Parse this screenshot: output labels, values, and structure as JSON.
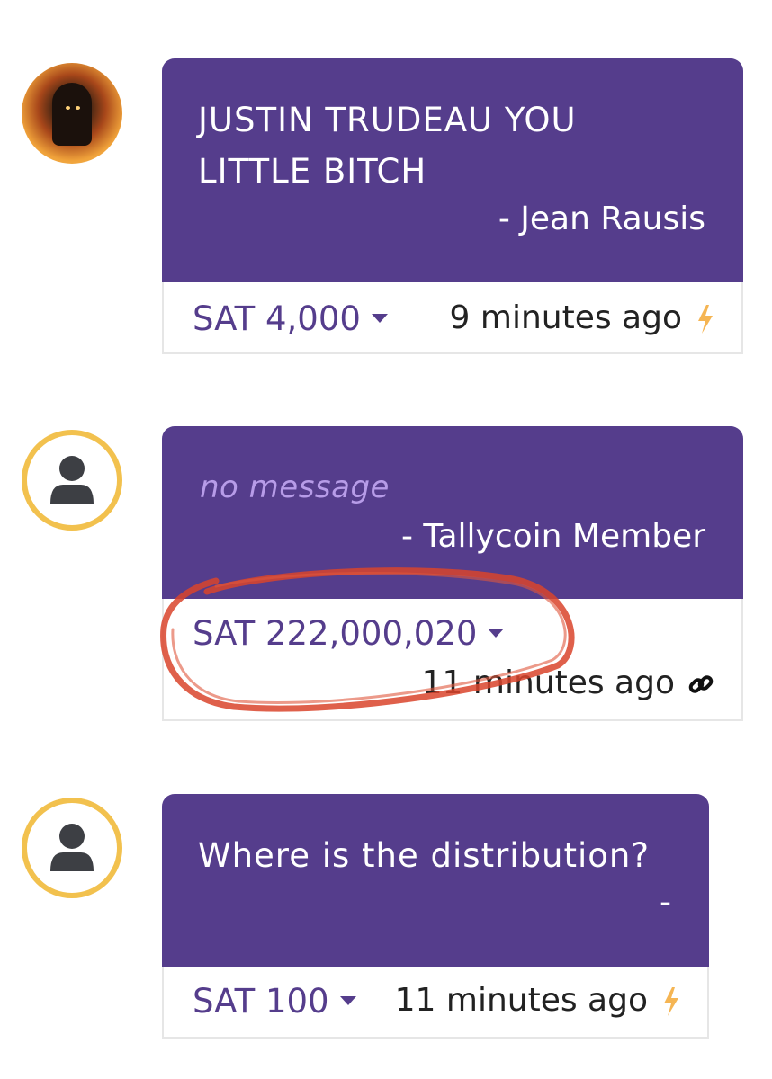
{
  "feed": {
    "items": [
      {
        "message": "JUSTIN TRUDEAU YOU LITTLE BITCH",
        "message_lines": [
          "JUSTIN TRUDEAU YOU",
          "LITTLE BITCH"
        ],
        "author": "- Jean Rausis",
        "amount": "SAT 4,000",
        "time": "9 minutes ago",
        "status_icon": "lightning-icon",
        "avatar": "user-photo"
      },
      {
        "message": "no message",
        "author": "- Tallycoin Member",
        "amount": "SAT 222,000,020",
        "time": "11 minutes ago",
        "status_icon": "link-icon",
        "avatar": "default-user-icon"
      },
      {
        "message": "Where is the distribution?",
        "author": "-",
        "amount": "SAT 100",
        "time": "11 minutes ago",
        "status_icon": "lightning-icon",
        "avatar": "default-user-icon"
      }
    ]
  },
  "colors": {
    "card_purple": "#553d8c",
    "amount_text": "#553d8c",
    "placeholder_text": "#b79ce8",
    "avatar_ring": "#f2c14e",
    "lightning": "#f5b553",
    "annotation_circle": "#d9442b"
  }
}
